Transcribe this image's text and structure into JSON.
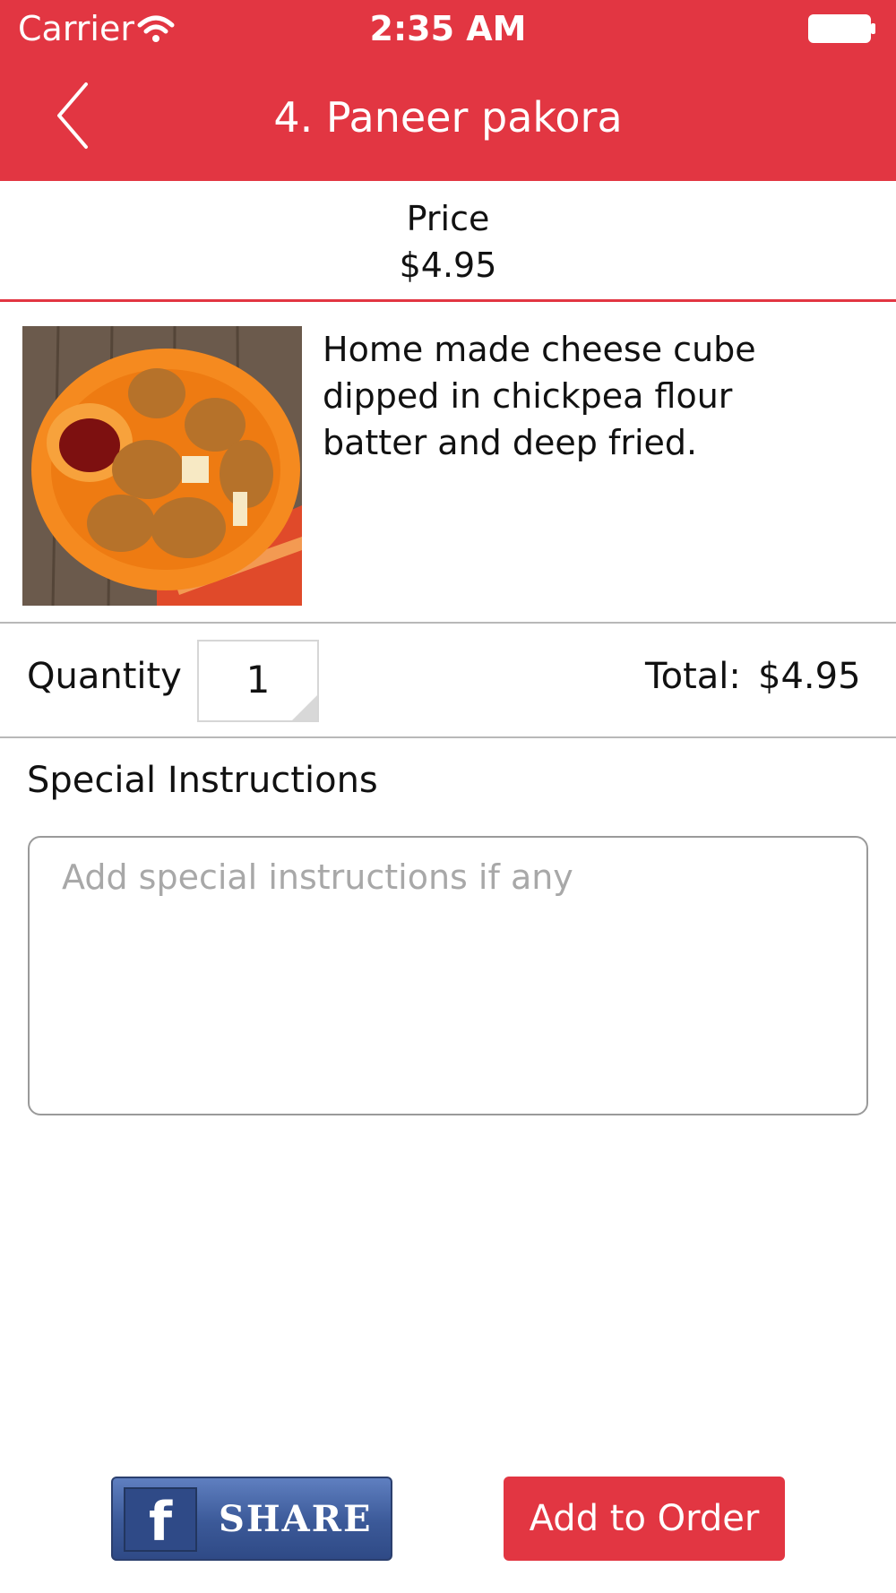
{
  "status_bar": {
    "carrier": "Carrier",
    "time": "2:35 AM"
  },
  "nav": {
    "title": "4. Paneer pakora"
  },
  "price": {
    "label": "Price",
    "value": "$4.95"
  },
  "item": {
    "description": "Home made cheese cube dipped in chickpea flour batter and deep fried."
  },
  "quantity": {
    "label": "Quantity",
    "value": "1"
  },
  "total": {
    "label": "Total:",
    "value": "$4.95"
  },
  "special_instructions": {
    "label": "Special Instructions",
    "placeholder": "Add special instructions if any"
  },
  "buttons": {
    "share_label": "SHARE",
    "add_to_order_label": "Add to Order"
  },
  "colors": {
    "brand_red": "#e23642",
    "facebook_blue": "#3b5998"
  }
}
